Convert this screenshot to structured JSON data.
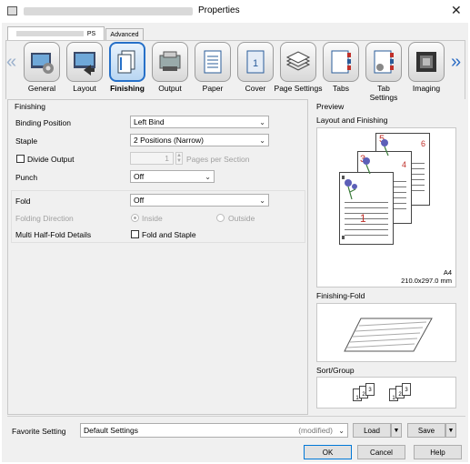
{
  "window": {
    "title": "Properties",
    "close_glyph": "✕"
  },
  "tabs": [
    {
      "label": "PS"
    },
    {
      "label": "Advanced"
    }
  ],
  "toolbar": [
    {
      "label": "General"
    },
    {
      "label": "Layout"
    },
    {
      "label": "Finishing"
    },
    {
      "label": "Output"
    },
    {
      "label": "Paper"
    },
    {
      "label": "Cover"
    },
    {
      "label": "Page Settings"
    },
    {
      "label": "Tabs"
    },
    {
      "label": "Tab Settings"
    },
    {
      "label": "Imaging"
    }
  ],
  "finishing": {
    "section": "Finishing",
    "binding_label": "Binding Position",
    "binding_value": "Left Bind",
    "staple_label": "Staple",
    "staple_value": "2 Positions (Narrow)",
    "divide_label": "Divide Output",
    "divide_value": "1",
    "pages_per_section": "Pages per Section",
    "punch_label": "Punch",
    "punch_value": "Off",
    "fold_label": "Fold",
    "fold_value": "Off",
    "folding_direction_label": "Folding Direction",
    "inside": "Inside",
    "outside": "Outside",
    "multi_label": "Multi Half-Fold Details",
    "fold_staple_label": "Fold and Staple"
  },
  "preview": {
    "section": "Preview",
    "layout_title": "Layout and Finishing",
    "paper_size": "A4",
    "paper_dims": "210.0x297.0 mm",
    "page_numbers": [
      "5",
      "6",
      "3",
      "4",
      "1"
    ],
    "finishing_fold_title": "Finishing-Fold",
    "sort_group_title": "Sort/Group",
    "sort_digits": [
      "1",
      "2",
      "3"
    ]
  },
  "favorite": {
    "label": "Favorite Setting",
    "value": "Default Settings",
    "modified": "(modified)",
    "load": "Load",
    "save": "Save"
  },
  "buttons": {
    "ok": "OK",
    "cancel": "Cancel",
    "help": "Help"
  },
  "colors": {
    "accent": "#2670c8",
    "page_number_red": "#c0302a",
    "flower_purple": "#5c5fb8"
  }
}
